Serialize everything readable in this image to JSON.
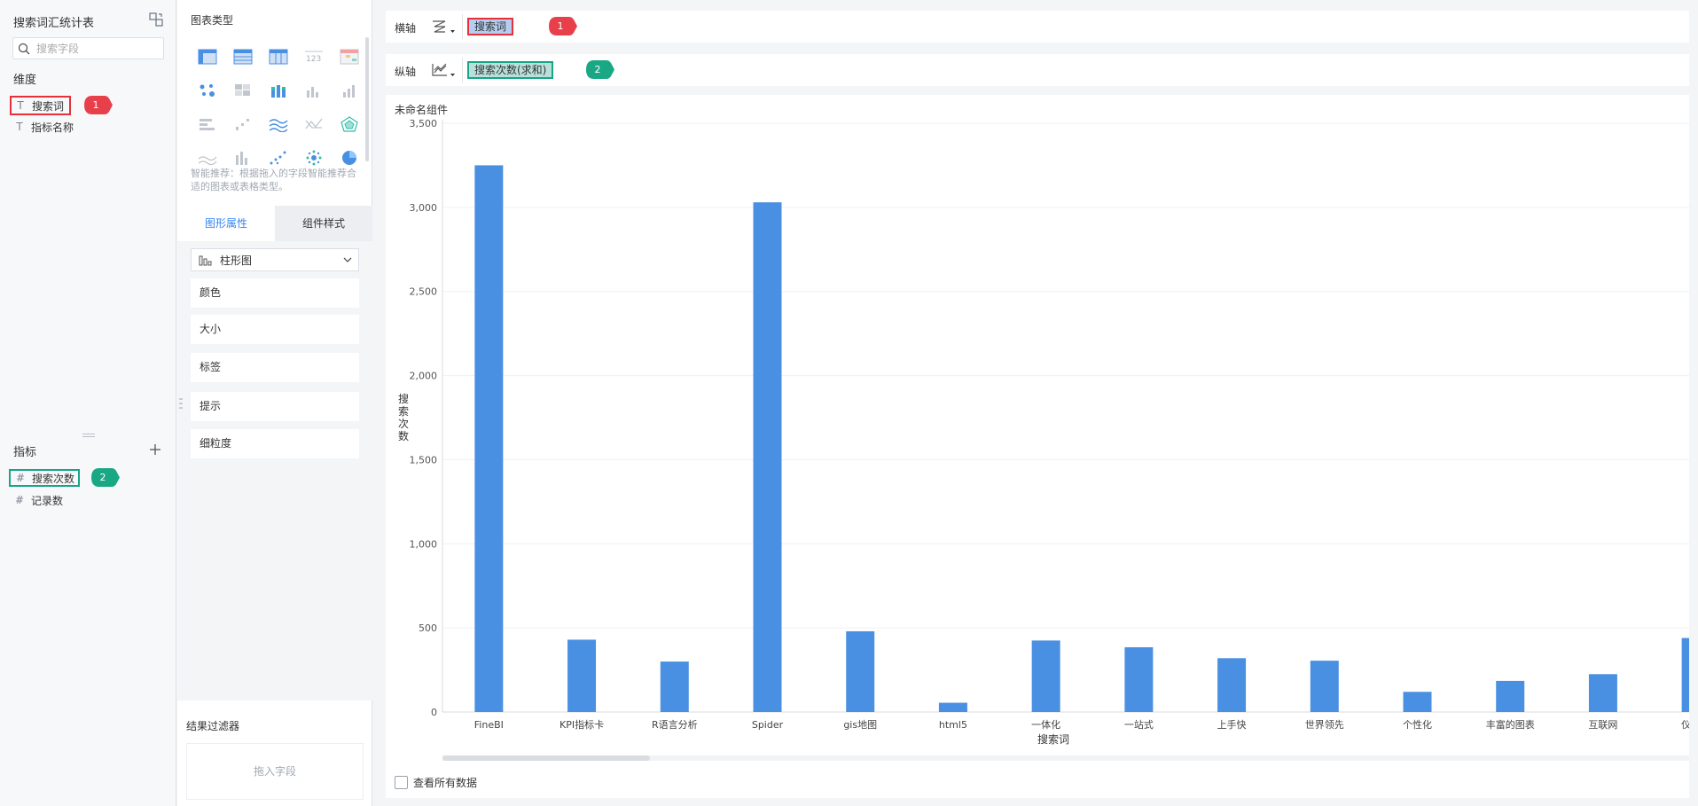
{
  "left": {
    "dataset_title": "搜索词汇统计表",
    "search_placeholder": "搜索字段",
    "dimensions_label": "维度",
    "dimensions": [
      {
        "type_glyph": "T",
        "label": "搜索词"
      },
      {
        "type_glyph": "T",
        "label": "指标名称"
      }
    ],
    "metrics_label": "指标",
    "metrics": [
      {
        "type_glyph": "#",
        "label": "搜索次数"
      },
      {
        "type_glyph": "#",
        "label": "记录数"
      }
    ],
    "badges": {
      "one": "1",
      "two": "2"
    }
  },
  "middle": {
    "chart_type_title": "图表类型",
    "chart_type_icons": [
      "cross-table-icon",
      "detail-table-icon",
      "grouped-table-icon",
      "kpi-number-icon",
      "color-table-icon",
      "scatter-grid-icon",
      "heat-grid-icon",
      "stacked-bar-icon",
      "bar-chart-icon",
      "column-chart-icon",
      "horizontal-bar-icon",
      "scatter-icon",
      "multi-line-icon",
      "line-cross-icon",
      "radar-icon",
      "area-icon",
      "column-gray-icon",
      "point-icon",
      "bubble-icon",
      "pie-icon"
    ],
    "hint": "智能推荐：根据拖入的字段智能推荐合适的图表或表格类型。",
    "tabs": {
      "graph_props": "图形属性",
      "component_style": "组件样式"
    },
    "chart_select": "柱形图",
    "props": [
      "颜色",
      "大小",
      "标签",
      "提示",
      "细粒度"
    ],
    "filter_title": "结果过滤器",
    "filter_drop": "拖入字段"
  },
  "right": {
    "x_axis_label": "横轴",
    "x_axis_field": "搜索词",
    "y_axis_label": "纵轴",
    "y_axis_field": "搜索次数(求和)",
    "component_name": "未命名组件",
    "show_all": "查看所有数据",
    "badges": {
      "one": "1",
      "two": "2"
    }
  },
  "colors": {
    "bar": "#4a90e2",
    "red": "#e6303a",
    "green": "#19a486",
    "active_tab": "#3685f2"
  },
  "chart_data": {
    "type": "bar",
    "title": "",
    "xlabel": "搜索词",
    "ylabel": "搜索次数",
    "ylim": [
      0,
      3500
    ],
    "yticks": [
      0,
      500,
      1000,
      1500,
      2000,
      2500,
      3000,
      3500
    ],
    "ytick_labels": [
      "0",
      "500",
      "1,000",
      "1,500",
      "2,000",
      "2,500",
      "3,000",
      "3,500"
    ],
    "grid": true,
    "categories": [
      "FineBI",
      "KPI指标卡",
      "R语言分析",
      "Spider",
      "gis地图",
      "html5",
      "一体化",
      "一站式",
      "上手快",
      "世界领先",
      "个性化",
      "丰富的图表",
      "互联网",
      "仪表板"
    ],
    "values": [
      3250,
      430,
      300,
      3030,
      480,
      55,
      425,
      385,
      320,
      305,
      120,
      185,
      225,
      440
    ]
  }
}
